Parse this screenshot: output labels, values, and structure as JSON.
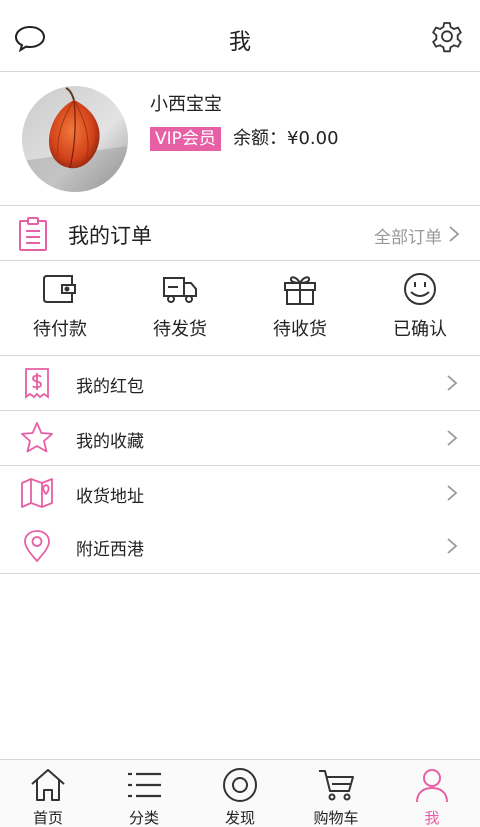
{
  "header": {
    "title": "我",
    "message_icon": "chat-bubble-icon",
    "settings_icon": "gear-icon"
  },
  "profile": {
    "username": "小西宝宝",
    "vip_label": "VIP会员",
    "balance_label": "余额：¥0.00"
  },
  "orders": {
    "title": "我的订单",
    "all_label": "全部订单",
    "statuses": [
      {
        "label": "待付款",
        "icon": "wallet-icon"
      },
      {
        "label": "待发货",
        "icon": "truck-icon"
      },
      {
        "label": "待收货",
        "icon": "gift-icon"
      },
      {
        "label": "已确认",
        "icon": "smile-icon"
      }
    ]
  },
  "menu": {
    "items": [
      {
        "label": "我的红包",
        "icon": "red-envelope-icon"
      },
      {
        "label": "我的收藏",
        "icon": "star-icon"
      },
      {
        "label": "收货地址",
        "icon": "map-icon"
      },
      {
        "label": "附近西港",
        "icon": "location-pin-icon"
      }
    ]
  },
  "tabbar": {
    "items": [
      {
        "label": "首页",
        "icon": "home-icon",
        "active": false
      },
      {
        "label": "分类",
        "icon": "list-icon",
        "active": false
      },
      {
        "label": "发现",
        "icon": "discover-icon",
        "active": false
      },
      {
        "label": "购物车",
        "icon": "cart-icon",
        "active": false
      },
      {
        "label": "我",
        "icon": "person-icon",
        "active": true
      }
    ]
  },
  "colors": {
    "accent": "#e75fa5",
    "text": "#222222",
    "muted": "#999999",
    "divider": "#d9d9d9"
  }
}
